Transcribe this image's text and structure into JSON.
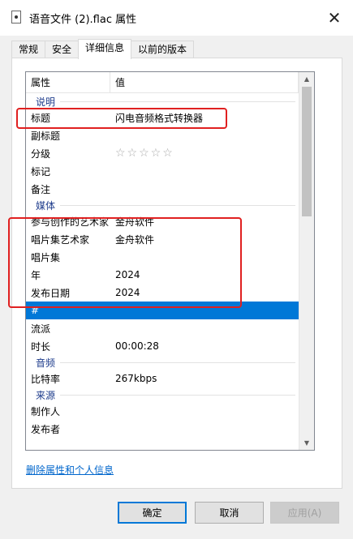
{
  "window": {
    "title": "语音文件 (2).flac 属性",
    "close_glyph": "✕"
  },
  "tabs": [
    {
      "label": "常规"
    },
    {
      "label": "安全"
    },
    {
      "label": "详细信息"
    },
    {
      "label": "以前的版本"
    }
  ],
  "list": {
    "header_property": "属性",
    "header_value": "值",
    "group_description": "说明",
    "title_label": "标题",
    "title_value": "闪电音频格式转换器",
    "subtitle_label": "副标题",
    "rating_label": "分级",
    "rating_stars": "☆☆☆☆☆",
    "tags_label": "标记",
    "comments_label": "备注",
    "group_media": "媒体",
    "contributing_artist_label": "参与创作的艺术家",
    "contributing_artist_value": "金舟软件",
    "album_artist_label": "唱片集艺术家",
    "album_artist_value": "金舟软件",
    "album_label": "唱片集",
    "year_label": "年",
    "year_value": "2024",
    "release_date_label": "发布日期",
    "release_date_value": "2024",
    "track_label": "#",
    "genre_label": "流派",
    "length_label": "时长",
    "length_value": "00:00:28",
    "group_audio": "音频",
    "bitrate_label": "比特率",
    "bitrate_value": "267kbps",
    "group_origin": "来源",
    "producer_label": "制作人",
    "publisher_label": "发布者"
  },
  "scroll": {
    "up_glyph": "▲",
    "down_glyph": "▼"
  },
  "remove_link": "删除属性和个人信息",
  "buttons": {
    "ok": "确定",
    "cancel": "取消",
    "apply": "应用(A)"
  }
}
